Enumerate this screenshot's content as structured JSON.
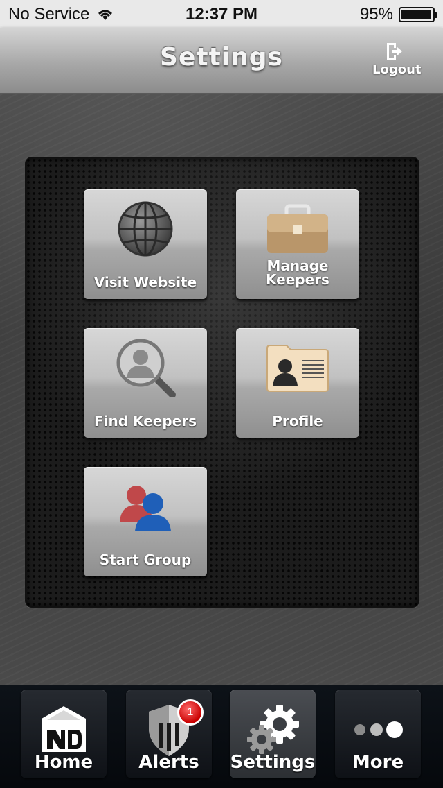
{
  "status_bar": {
    "carrier": "No Service",
    "time": "12:37 PM",
    "battery_text": "95%",
    "battery_level": 0.95
  },
  "nav": {
    "title": "Settings",
    "logout_label": "Logout"
  },
  "tiles": [
    {
      "label": "Visit Website",
      "icon": "globe-icon"
    },
    {
      "label_line1": "Manage",
      "label_line2": "Keepers",
      "icon": "briefcase-icon"
    },
    {
      "label": "Find Keepers",
      "icon": "magnifier-person-icon"
    },
    {
      "label": "Profile",
      "icon": "profile-folder-icon"
    },
    {
      "label": "Start Group",
      "icon": "group-icon"
    }
  ],
  "tabs": [
    {
      "label": "Home",
      "icon": "home-icon"
    },
    {
      "label": "Alerts",
      "icon": "shield-icon",
      "badge": "1"
    },
    {
      "label": "Settings",
      "icon": "gear-icon",
      "active": true
    },
    {
      "label": "More",
      "icon": "more-dots-icon"
    }
  ],
  "colors": {
    "badge": "#c90000",
    "nav_title": "#f4f4f4"
  }
}
